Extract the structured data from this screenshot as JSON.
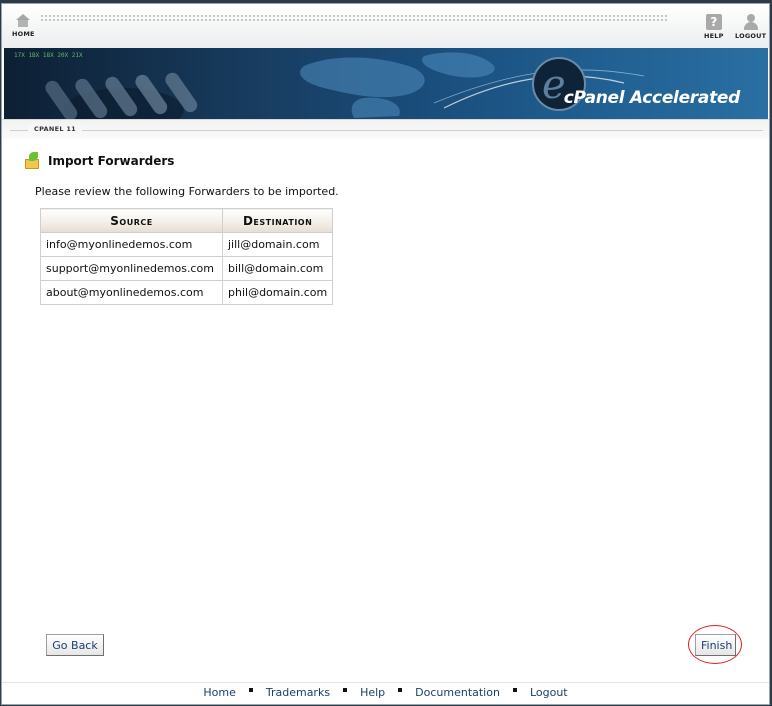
{
  "topnav": {
    "home_label": "HOME",
    "help_label": "HELP",
    "logout_label": "LOGOUT"
  },
  "banner": {
    "logo_text": "cPanel Accelerated"
  },
  "tab": {
    "label": "CPANEL 11"
  },
  "page": {
    "title": "Import Forwarders",
    "intro": "Please review the following Forwarders to be imported."
  },
  "table": {
    "headers": [
      "Source",
      "Destination"
    ],
    "rows": [
      [
        "info@myonlinedemos.com",
        "jill@domain.com"
      ],
      [
        "support@myonlinedemos.com",
        "bill@domain.com"
      ],
      [
        "about@myonlinedemos.com",
        "phil@domain.com"
      ]
    ]
  },
  "buttons": {
    "go_back": "Go Back",
    "finish": "Finish"
  },
  "footer": {
    "links": [
      "Home",
      "Trademarks",
      "Help",
      "Documentation",
      "Logout"
    ]
  },
  "colors": {
    "link": "#1d3f6b",
    "highlight": "#e02020",
    "banner_dark": "#0d1f33",
    "banner_light": "#2a6fa3"
  },
  "icons": {
    "home": "home-icon",
    "help": "help-icon",
    "logout": "logout-icon",
    "import": "import-forwarders-icon"
  }
}
